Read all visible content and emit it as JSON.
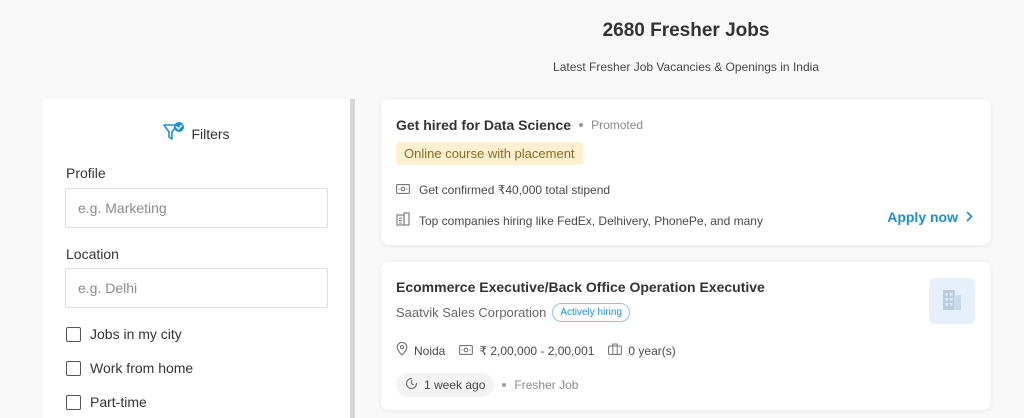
{
  "header": {
    "title": "2680 Fresher Jobs",
    "subtitle": "Latest Fresher Job Vacancies & Openings in India"
  },
  "filters": {
    "title": "Filters",
    "profile_label": "Profile",
    "profile_placeholder": "e.g. Marketing",
    "location_label": "Location",
    "location_placeholder": "e.g. Delhi",
    "checkboxes": [
      "Jobs in my city",
      "Work from home",
      "Part-time"
    ]
  },
  "promo_card": {
    "title": "Get hired for Data Science",
    "promoted_label": "Promoted",
    "tag": "Online course with placement",
    "stipend_text": "Get confirmed ₹40,000 total stipend",
    "companies_text": "Top companies hiring like FedEx, Delhivery, PhonePe, and many",
    "apply_label": "Apply now"
  },
  "job_card": {
    "title": "Ecommerce Executive/Back Office Operation Executive",
    "company": "Saatvik Sales Corporation",
    "badge": "Actively hiring",
    "location": "Noida",
    "salary": "₹ 2,00,000 - 2,00,001",
    "experience": "0 year(s)",
    "posted": "1 week ago",
    "job_type": "Fresher Job"
  },
  "colors": {
    "accent": "#1c8fd6",
    "promo_tag_bg": "#fdf0d2",
    "page_bg": "#f8f8f8"
  }
}
